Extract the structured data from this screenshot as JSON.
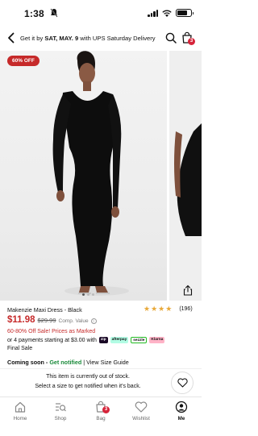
{
  "status_bar": {
    "time": "1:38"
  },
  "header": {
    "delivery_prefix": "Get it by ",
    "delivery_date": "SAT, MAY. 9",
    "delivery_suffix": " with UPS Saturday Delivery",
    "bag_count": "3"
  },
  "gallery": {
    "sale_badge": "60% OFF"
  },
  "product": {
    "title": "Makenzie Maxi Dress - Black",
    "rating_stars": 4,
    "rating_count": "(196)",
    "price_now": "$11.98",
    "price_was": "$29.99",
    "comp_value_label": "Comp. Value",
    "promo": "60-80% Off Sale! Prices as Marked",
    "installments_text": "or 4 payments starting at $3.00 with",
    "pay_logos": [
      "zip",
      "afterpay",
      "sezzle",
      "Klarna"
    ],
    "final_sale": "Final Sale",
    "coming_soon": "Coming soon - ",
    "get_notified": "Get notified",
    "separator": " | ",
    "size_guide": "View Size Guide"
  },
  "oos": {
    "line1": "This item is currently out of stock.",
    "line2": "Select a size to get notified when it's back."
  },
  "tabbar": {
    "tabs": [
      {
        "label": "Home",
        "icon": "home-icon"
      },
      {
        "label": "Shop",
        "icon": "shop-search-icon"
      },
      {
        "label": "Bag",
        "icon": "bag-icon",
        "badge": "3"
      },
      {
        "label": "Wishlist",
        "icon": "heart-icon"
      },
      {
        "label": "Me",
        "icon": "person-icon"
      }
    ]
  },
  "colors": {
    "sale_red": "#c62a2a",
    "notify_green": "#1a8a3a",
    "star": "#e8a838",
    "badge": "#d6243a"
  }
}
